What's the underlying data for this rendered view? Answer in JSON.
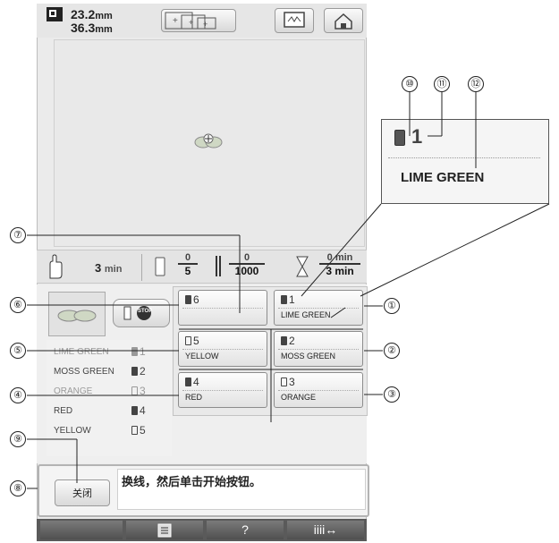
{
  "topbar": {
    "width_value": "23.2",
    "height_value": "36.3",
    "unit": "mm"
  },
  "infobar": {
    "time_value": "3",
    "time_unit": "min",
    "color_count_done": "0",
    "color_count_total": "5",
    "stitch_done": "0",
    "stitch_total": "1000",
    "time_done": "0",
    "time_total": "3",
    "time_done_unit": "min",
    "time_total_unit": "min"
  },
  "color_list": [
    {
      "name": "LIME GREEN",
      "num": "1"
    },
    {
      "name": "MOSS GREEN",
      "num": "2"
    },
    {
      "name": "ORANGE",
      "num": "3"
    },
    {
      "name": "RED",
      "num": "4"
    },
    {
      "name": "YELLOW",
      "num": "5"
    }
  ],
  "spools": [
    {
      "num": "6",
      "name": ""
    },
    {
      "num": "1",
      "name": "LIME GREEN"
    },
    {
      "num": "5",
      "name": "YELLOW"
    },
    {
      "num": "2",
      "name": "MOSS GREEN"
    },
    {
      "num": "4",
      "name": "RED"
    },
    {
      "num": "3",
      "name": "ORANGE"
    }
  ],
  "stop_label": "STOP",
  "message": {
    "close_label": "关闭",
    "text": "换线，然后单击开始按钮。"
  },
  "callouts": {
    "c1": "①",
    "c2": "②",
    "c3": "③",
    "c4": "④",
    "c5": "⑤",
    "c6": "⑥",
    "c7": "⑦",
    "c8": "⑧",
    "c9": "⑨",
    "c10": "⑩",
    "c11": "⑪",
    "c12": "⑫"
  },
  "zoom": {
    "num": "1",
    "name": "LIME GREEN"
  },
  "bottom_bar": {
    "help_label": "?",
    "arrows_label": "iiii↔"
  }
}
